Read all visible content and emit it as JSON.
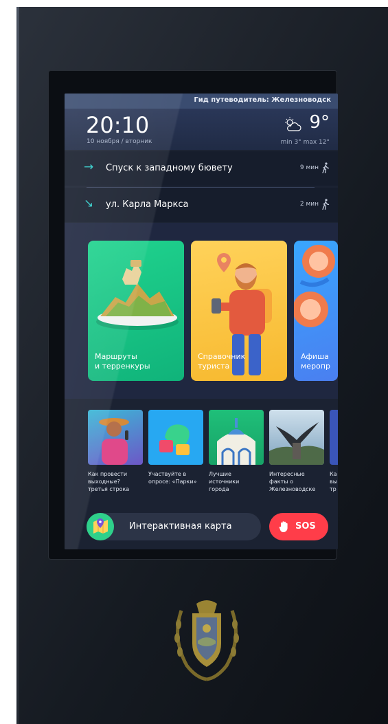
{
  "header": {
    "title": "Гид путеводитель: Железноводск"
  },
  "clock": {
    "time": "20:10",
    "date": "10 ноября / вторник"
  },
  "weather": {
    "icon": "partly-cloudy-icon",
    "temperature": "9°",
    "range": "min 3°  max 12°"
  },
  "routes": [
    {
      "arrow": "→",
      "label": "Спуск к западному бювету",
      "duration": "9 мин",
      "icon": "walking-person-icon"
    },
    {
      "arrow": "↘",
      "label": "ул. Карла Маркса",
      "duration": "2 мин",
      "icon": "walking-person-icon"
    }
  ],
  "cards": [
    {
      "line1": "Маршруты",
      "line2": "и терренкуры",
      "color": "#1cc987"
    },
    {
      "line1": "Справочник",
      "line2": "туриста",
      "color": "#fbc640"
    },
    {
      "line1": "Афиша",
      "line2": "меропр",
      "color": "#3f8ff5"
    }
  ],
  "news": [
    {
      "lines": [
        "Как провести",
        "выходные?",
        "третья строка"
      ]
    },
    {
      "lines": [
        "Участвуйте в",
        "опросе: «Парки»",
        ""
      ]
    },
    {
      "lines": [
        "Лучшие",
        "источники",
        "города"
      ]
    },
    {
      "lines": [
        "Интересные",
        "факты о",
        "Железноводске"
      ]
    },
    {
      "lines": [
        "Ка",
        "вы",
        "тр"
      ]
    }
  ],
  "bottom": {
    "map_label": "Интерактивная карта",
    "sos_label": "SOS"
  },
  "colors": {
    "accent_teal": "#2ec9c7",
    "sos_red": "#ff3d49",
    "map_green": "#2fd08b",
    "header_blue": "#3a4c70"
  }
}
